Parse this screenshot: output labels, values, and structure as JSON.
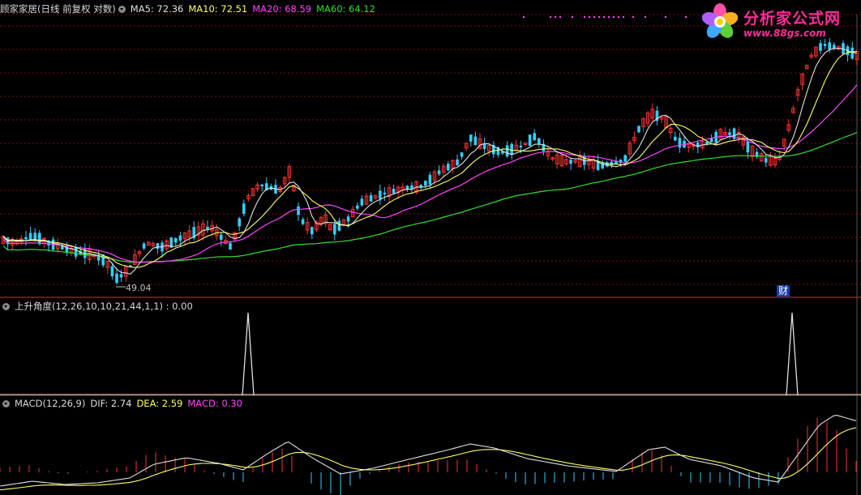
{
  "main_panel": {
    "title": "顾家家居(日线 前复权 对数)",
    "indicators": [
      {
        "label": "MA5: 72.36",
        "color": "#e0e0e0"
      },
      {
        "label": "MA10: 72.51",
        "color": "#ffff66"
      },
      {
        "label": "MA20: 68.59",
        "color": "#ff44ff"
      },
      {
        "label": "MA60: 64.12",
        "color": "#33dd33"
      }
    ],
    "low_label": "49.04",
    "event_badge": "财"
  },
  "angle_panel": {
    "title": "上升角度(12,26,10,10,21,44,1,1) : 0.00"
  },
  "macd_panel": {
    "title": "MACD(12,26,9)",
    "indicators": [
      {
        "label": "DIF: 2.74",
        "color": "#e0e0e0"
      },
      {
        "label": "DEA: 2.59",
        "color": "#ffff66"
      },
      {
        "label": "MACD: 0.30",
        "color": "#ff44ff"
      }
    ]
  },
  "logo": {
    "title": "分析家公式网",
    "url": "www.88gs.com"
  },
  "colors": {
    "up": "#ff3030",
    "down": "#30d0ff",
    "grid": "#7a1010",
    "divider": "#a01818",
    "ma5": "#e0e0e0",
    "ma10": "#ffff66",
    "ma20": "#ff44ff",
    "ma60": "#33dd33"
  }
}
